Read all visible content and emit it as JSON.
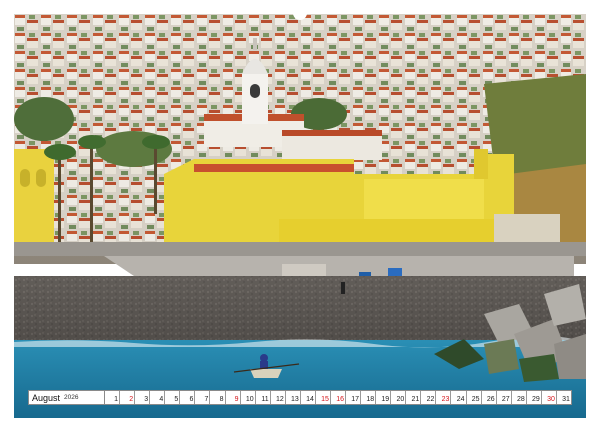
{
  "calendar": {
    "month": "August",
    "year": "2026",
    "days": [
      {
        "n": "1",
        "red": false
      },
      {
        "n": "2",
        "red": true
      },
      {
        "n": "3",
        "red": false
      },
      {
        "n": "4",
        "red": false
      },
      {
        "n": "5",
        "red": false
      },
      {
        "n": "6",
        "red": false
      },
      {
        "n": "7",
        "red": false
      },
      {
        "n": "8",
        "red": false
      },
      {
        "n": "9",
        "red": true
      },
      {
        "n": "10",
        "red": false
      },
      {
        "n": "11",
        "red": false
      },
      {
        "n": "12",
        "red": false
      },
      {
        "n": "13",
        "red": false
      },
      {
        "n": "14",
        "red": false
      },
      {
        "n": "15",
        "red": true
      },
      {
        "n": "16",
        "red": true
      },
      {
        "n": "17",
        "red": false
      },
      {
        "n": "18",
        "red": false
      },
      {
        "n": "19",
        "red": false
      },
      {
        "n": "20",
        "red": false
      },
      {
        "n": "21",
        "red": false
      },
      {
        "n": "22",
        "red": false
      },
      {
        "n": "23",
        "red": true
      },
      {
        "n": "24",
        "red": false
      },
      {
        "n": "25",
        "red": false
      },
      {
        "n": "26",
        "red": false
      },
      {
        "n": "27",
        "red": false
      },
      {
        "n": "28",
        "red": false
      },
      {
        "n": "29",
        "red": false
      },
      {
        "n": "30",
        "red": true
      },
      {
        "n": "31",
        "red": false
      }
    ]
  },
  "colors": {
    "sea": "#1f7fa6",
    "fort": "#e8d43a",
    "beach": "#5e5a57",
    "roofs": "#c8502e",
    "holiday": "#d4141a"
  }
}
